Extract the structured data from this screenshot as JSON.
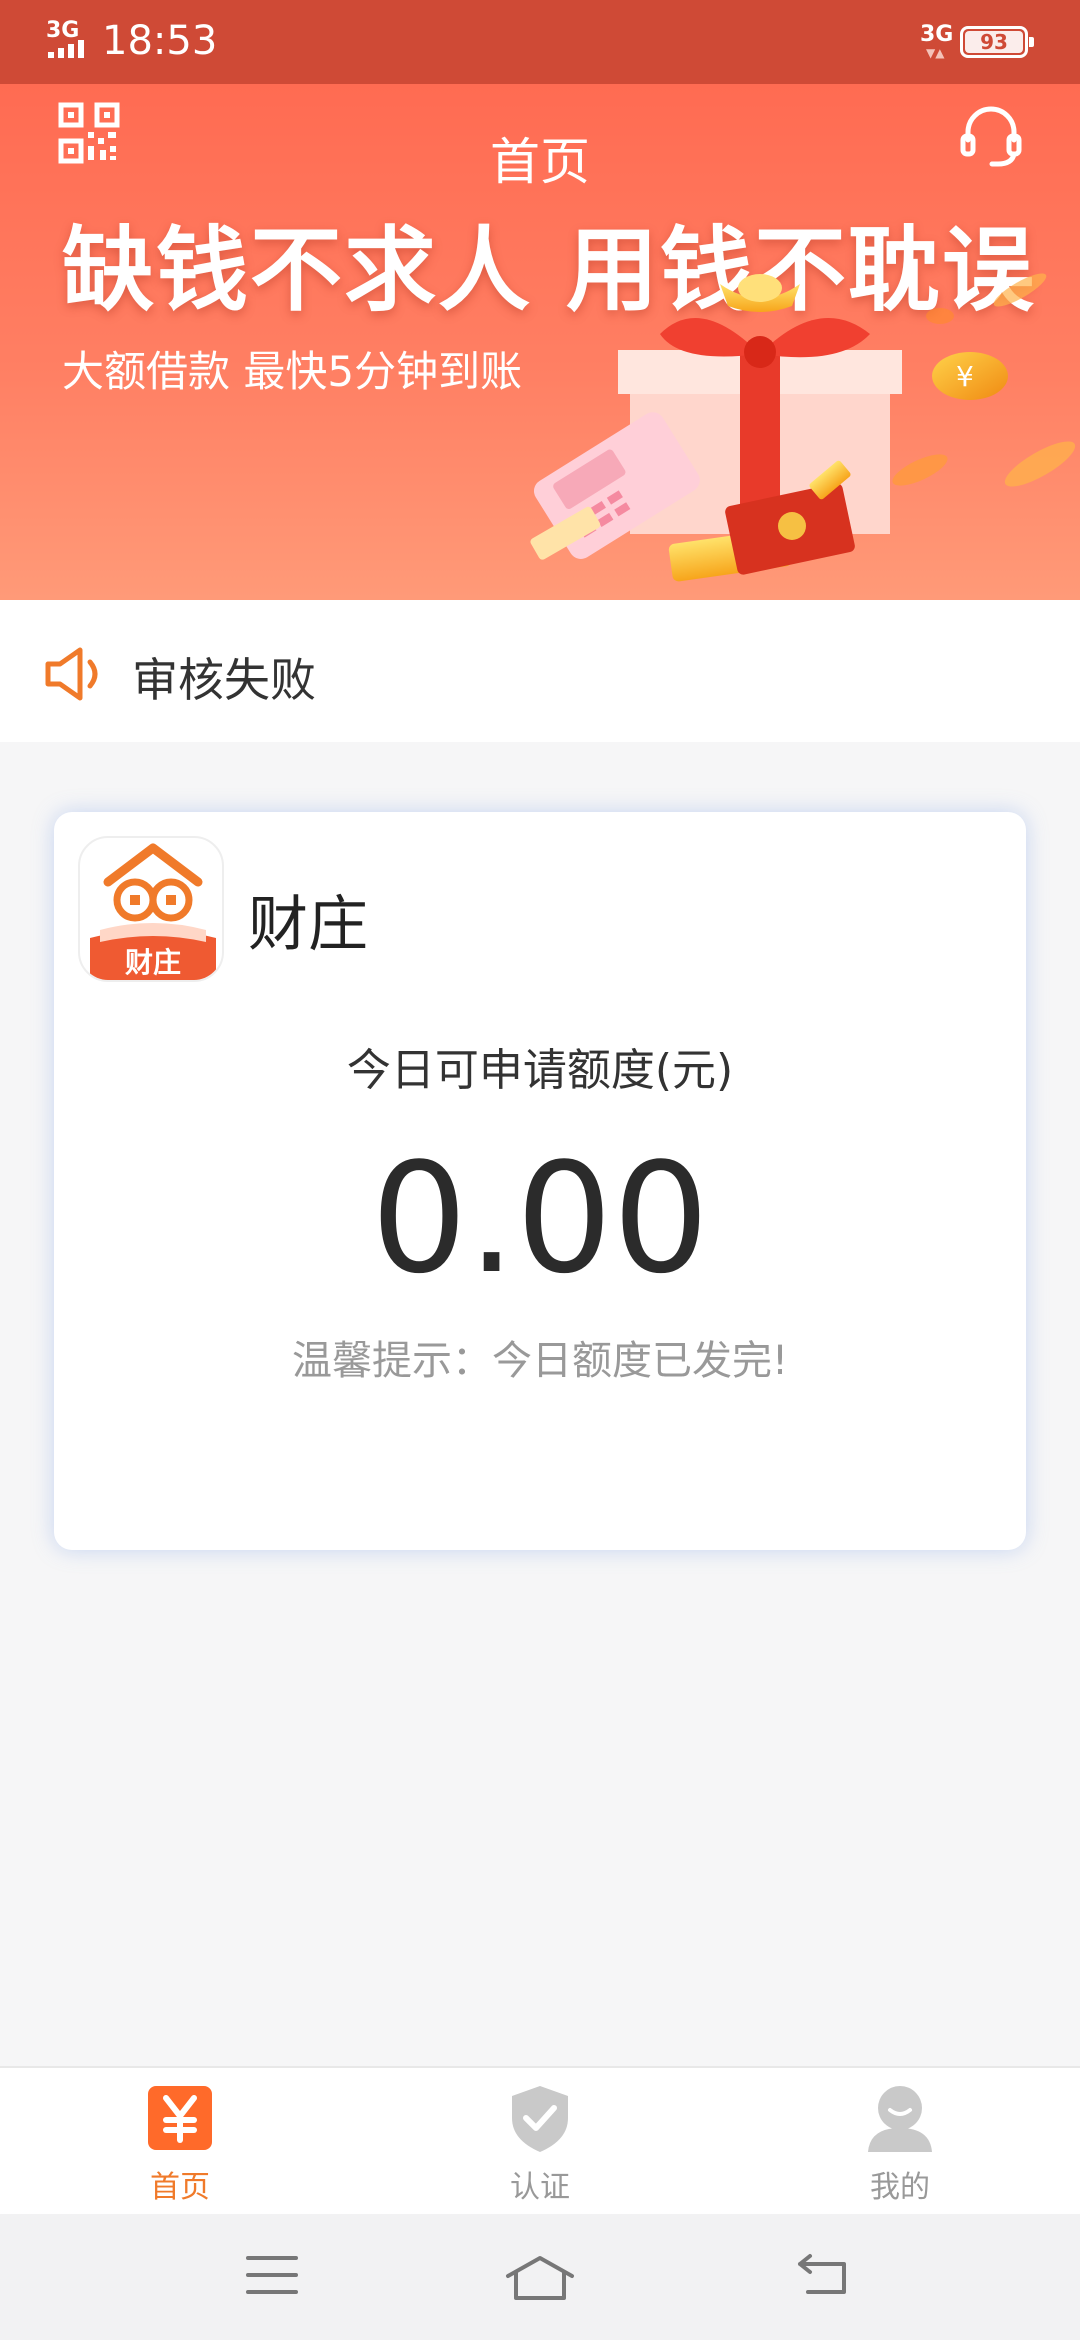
{
  "status_bar": {
    "signal_label": "3G",
    "time": "18:53",
    "network_label": "3G",
    "battery_level": "93"
  },
  "header": {
    "title": "首页"
  },
  "banner": {
    "slogan": "缺钱不求人 用钱不耽误",
    "subslogan": "大额借款 最快5分钟到账"
  },
  "notice": {
    "text": "审核失败"
  },
  "card": {
    "app_name": "财庄",
    "logo_text": "财庄",
    "quota_label": "今日可申请额度(元)",
    "quota_value": "0.00",
    "tip": "温馨提示：今日额度已发完!"
  },
  "tabbar": {
    "tabs": [
      {
        "label": "首页",
        "icon": "yen-icon",
        "active": true
      },
      {
        "label": "认证",
        "icon": "shield-check-icon",
        "active": false
      },
      {
        "label": "我的",
        "icon": "profile-icon",
        "active": false
      }
    ]
  },
  "colors": {
    "accent": "#f07a2a",
    "banner": "#ff6b52",
    "status_bar": "#cf4a36",
    "muted": "#999999"
  }
}
